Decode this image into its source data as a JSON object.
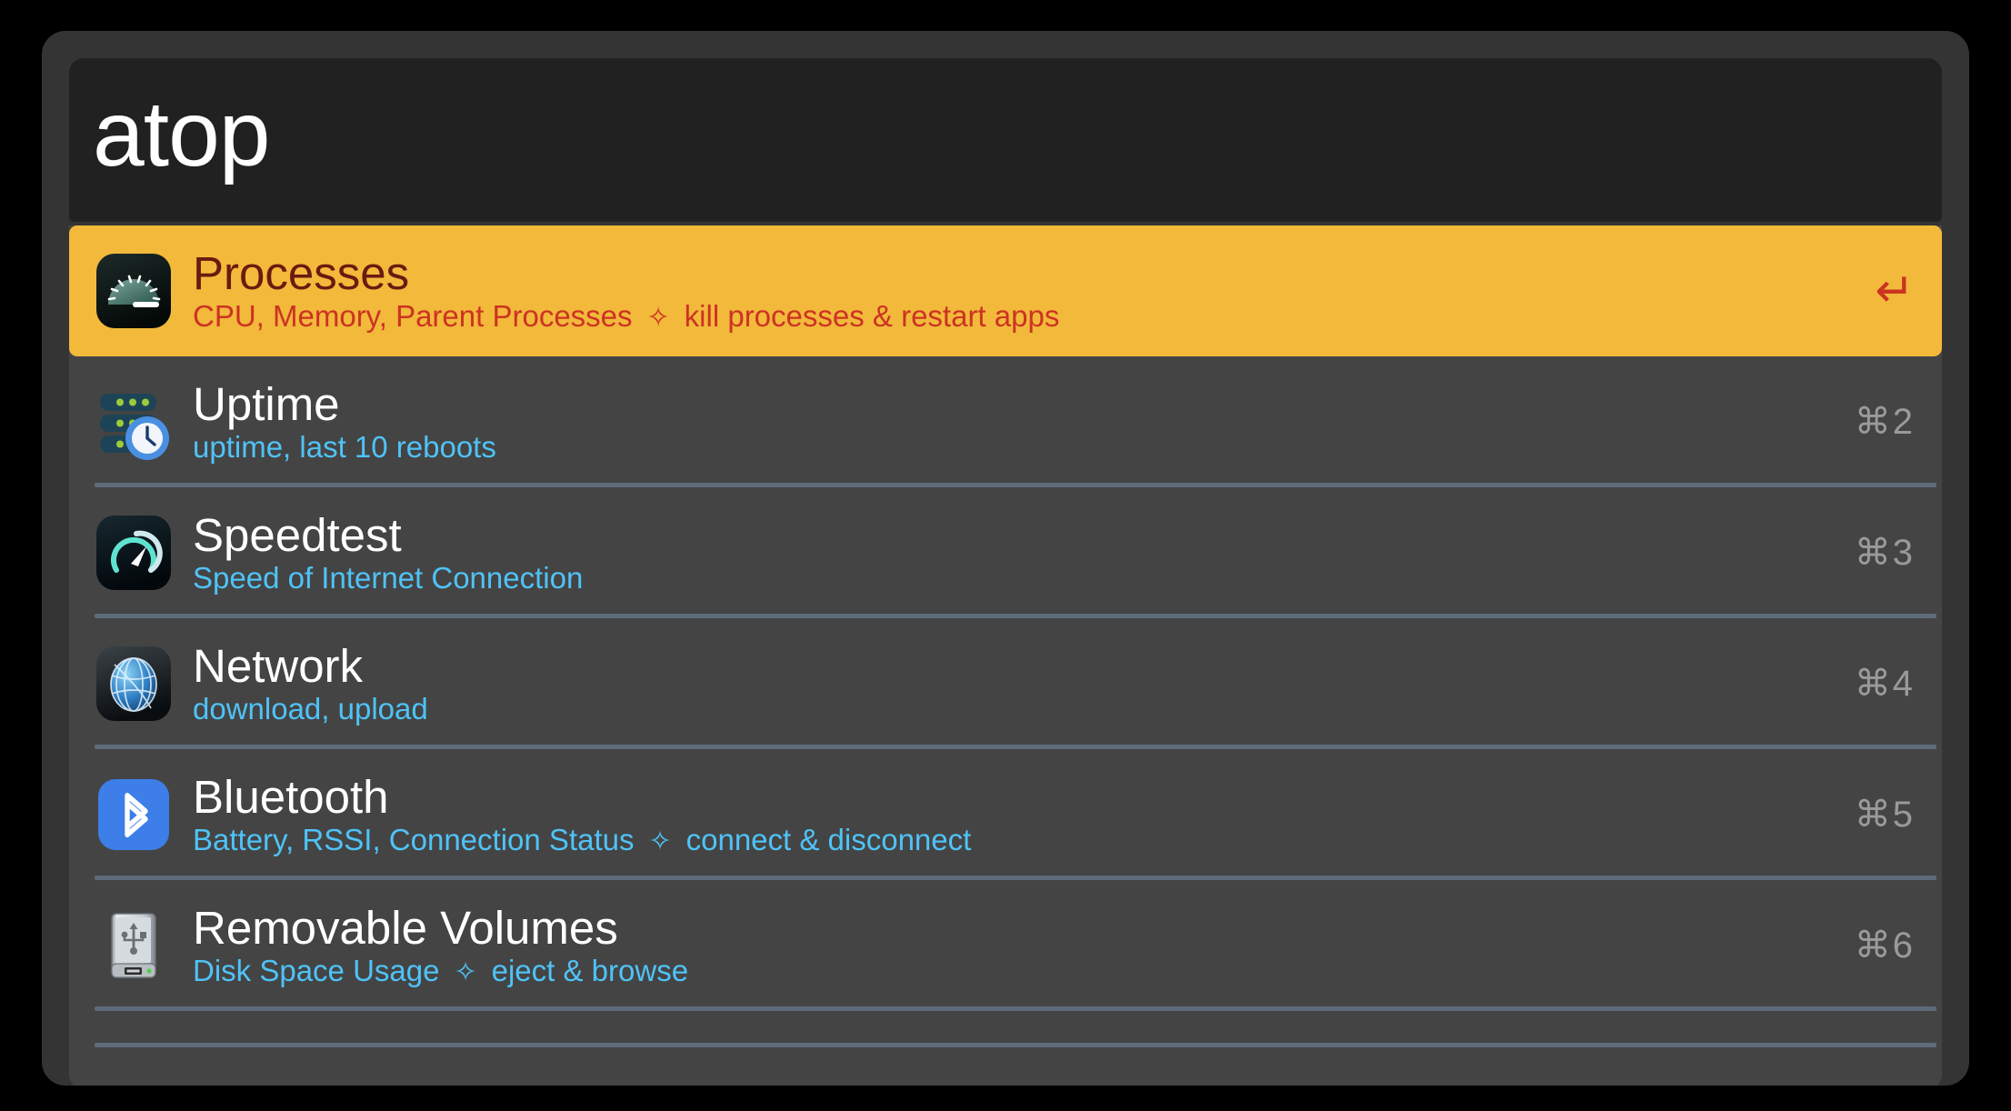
{
  "window": {
    "background_color": "#343434",
    "outer_background_color": "#000000"
  },
  "search": {
    "query": "atop",
    "placeholder": "atop",
    "background_color": "#212121",
    "text_color": "#ffffff"
  },
  "colors": {
    "selection": "#F2B93B",
    "selected_title": "#6B1A10",
    "selected_subtitle": "#CC3322",
    "list_background": "#444444",
    "subtitle_blue": "#4FC3F7",
    "separator": "#5E6B7A",
    "shortcut_gray": "#9A9A9A"
  },
  "results": [
    {
      "title": "Processes",
      "subtitle_main": "CPU, Memory, Parent Processes",
      "subtitle_separator": "✧",
      "subtitle_action": "kill processes & restart apps",
      "icon": "speedometer-gauge-icon",
      "accessory": "↵",
      "accessory_kind": "enter-key",
      "selected": true
    },
    {
      "title": "Uptime",
      "subtitle_main": "uptime, last 10 reboots",
      "subtitle_separator": "",
      "subtitle_action": "",
      "icon": "server-clock-icon",
      "accessory": "⌘2",
      "accessory_kind": "shortcut",
      "selected": false
    },
    {
      "title": "Speedtest",
      "subtitle_main": "Speed of Internet Connection",
      "subtitle_separator": "",
      "subtitle_action": "",
      "icon": "speedtest-gauge-icon",
      "accessory": "⌘3",
      "accessory_kind": "shortcut",
      "selected": false
    },
    {
      "title": "Network",
      "subtitle_main": "download, upload",
      "subtitle_separator": "",
      "subtitle_action": "",
      "icon": "globe-network-icon",
      "accessory": "⌘4",
      "accessory_kind": "shortcut",
      "selected": false
    },
    {
      "title": "Bluetooth",
      "subtitle_main": "Battery, RSSI, Connection Status",
      "subtitle_separator": "✧",
      "subtitle_action": "connect & disconnect",
      "icon": "bluetooth-icon",
      "accessory": "⌘5",
      "accessory_kind": "shortcut",
      "selected": false
    },
    {
      "title": "Removable Volumes",
      "subtitle_main": "Disk Space Usage",
      "subtitle_separator": "✧",
      "subtitle_action": "eject & browse",
      "icon": "external-drive-usb-icon",
      "accessory": "⌘6",
      "accessory_kind": "shortcut",
      "selected": false
    }
  ]
}
